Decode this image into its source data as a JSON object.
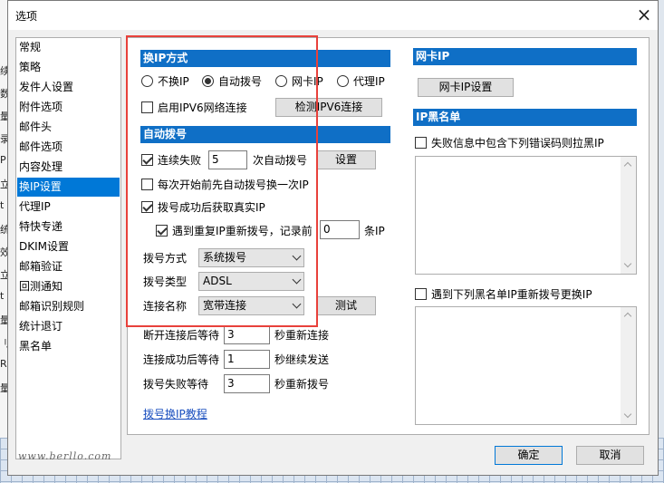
{
  "dialog": {
    "title": "选项",
    "close": "×"
  },
  "background": {
    "left_chars": [
      "续",
      "数",
      "量",
      "录",
      "P",
      "立",
      "t",
      "统",
      "效",
      "立",
      "t",
      "量",
      "刂",
      "R",
      "量"
    ]
  },
  "nav": {
    "items": [
      "常规",
      "策略",
      "发件人设置",
      "附件选项",
      "邮件头",
      "邮件选项",
      "内容处理",
      "换IP设置",
      "代理IP",
      "特快专递",
      "DKIM设置",
      "邮箱验证",
      "回测通知",
      "邮箱识别规则",
      "统计退订",
      "黑名单"
    ],
    "selected": "换IP设置"
  },
  "ip_method": {
    "header": "换IP方式",
    "options": [
      "不换IP",
      "自动拨号",
      "网卡IP",
      "代理IP"
    ],
    "selected": "自动拨号",
    "ipv6_enable": "启用IPV6网络连接",
    "ipv6_checked": false,
    "detect_ipv6": "检测IPV6连接"
  },
  "auto_dial": {
    "header": "自动拨号",
    "consecutive_fail_label": "连续失败",
    "consecutive_fail_checked": true,
    "consecutive_fail_value": "5",
    "auto_dial_suffix": "次自动拨号",
    "settings_btn": "设置",
    "dial_before_start": "每次开始前先自动拨号换一次IP",
    "dial_before_start_checked": false,
    "get_real_ip": "拨号成功后获取真实IP",
    "get_real_ip_checked": true,
    "redial_repeat": "遇到重复IP重新拨号，记录前",
    "redial_repeat_checked": true,
    "redial_repeat_value": "0",
    "redial_repeat_suffix": "条IP",
    "dial_method_label": "拨号方式",
    "dial_method_value": "系统拨号",
    "dial_type_label": "拨号类型",
    "dial_type_value": "ADSL",
    "conn_name_label": "连接名称",
    "conn_name_value": "宽带连接",
    "test_btn": "测试",
    "disconnect_wait_label": "断开连接后等待",
    "disconnect_wait_value": "3",
    "disconnect_wait_suffix": "秒重新连接",
    "connect_wait_label": "连接成功后等待",
    "connect_wait_value": "1",
    "connect_wait_suffix": "秒继续发送",
    "fail_wait_label": "拨号失败等待",
    "fail_wait_value": "3",
    "fail_wait_suffix": "秒重新拨号",
    "tutorial_link": "拨号换IP教程"
  },
  "nic_ip": {
    "header": "网卡IP",
    "settings_btn": "网卡IP设置"
  },
  "ip_blacklist": {
    "header": "IP黑名单",
    "fail_error_label": "失败信息中包含下列错误码则拉黑IP",
    "fail_error_checked": false,
    "redial_blacklist_label": "遇到下列黑名单IP重新拨号更换IP",
    "redial_blacklist_checked": false
  },
  "footer": {
    "ok": "确定",
    "cancel": "取消",
    "watermark": "www.berllo.com"
  }
}
